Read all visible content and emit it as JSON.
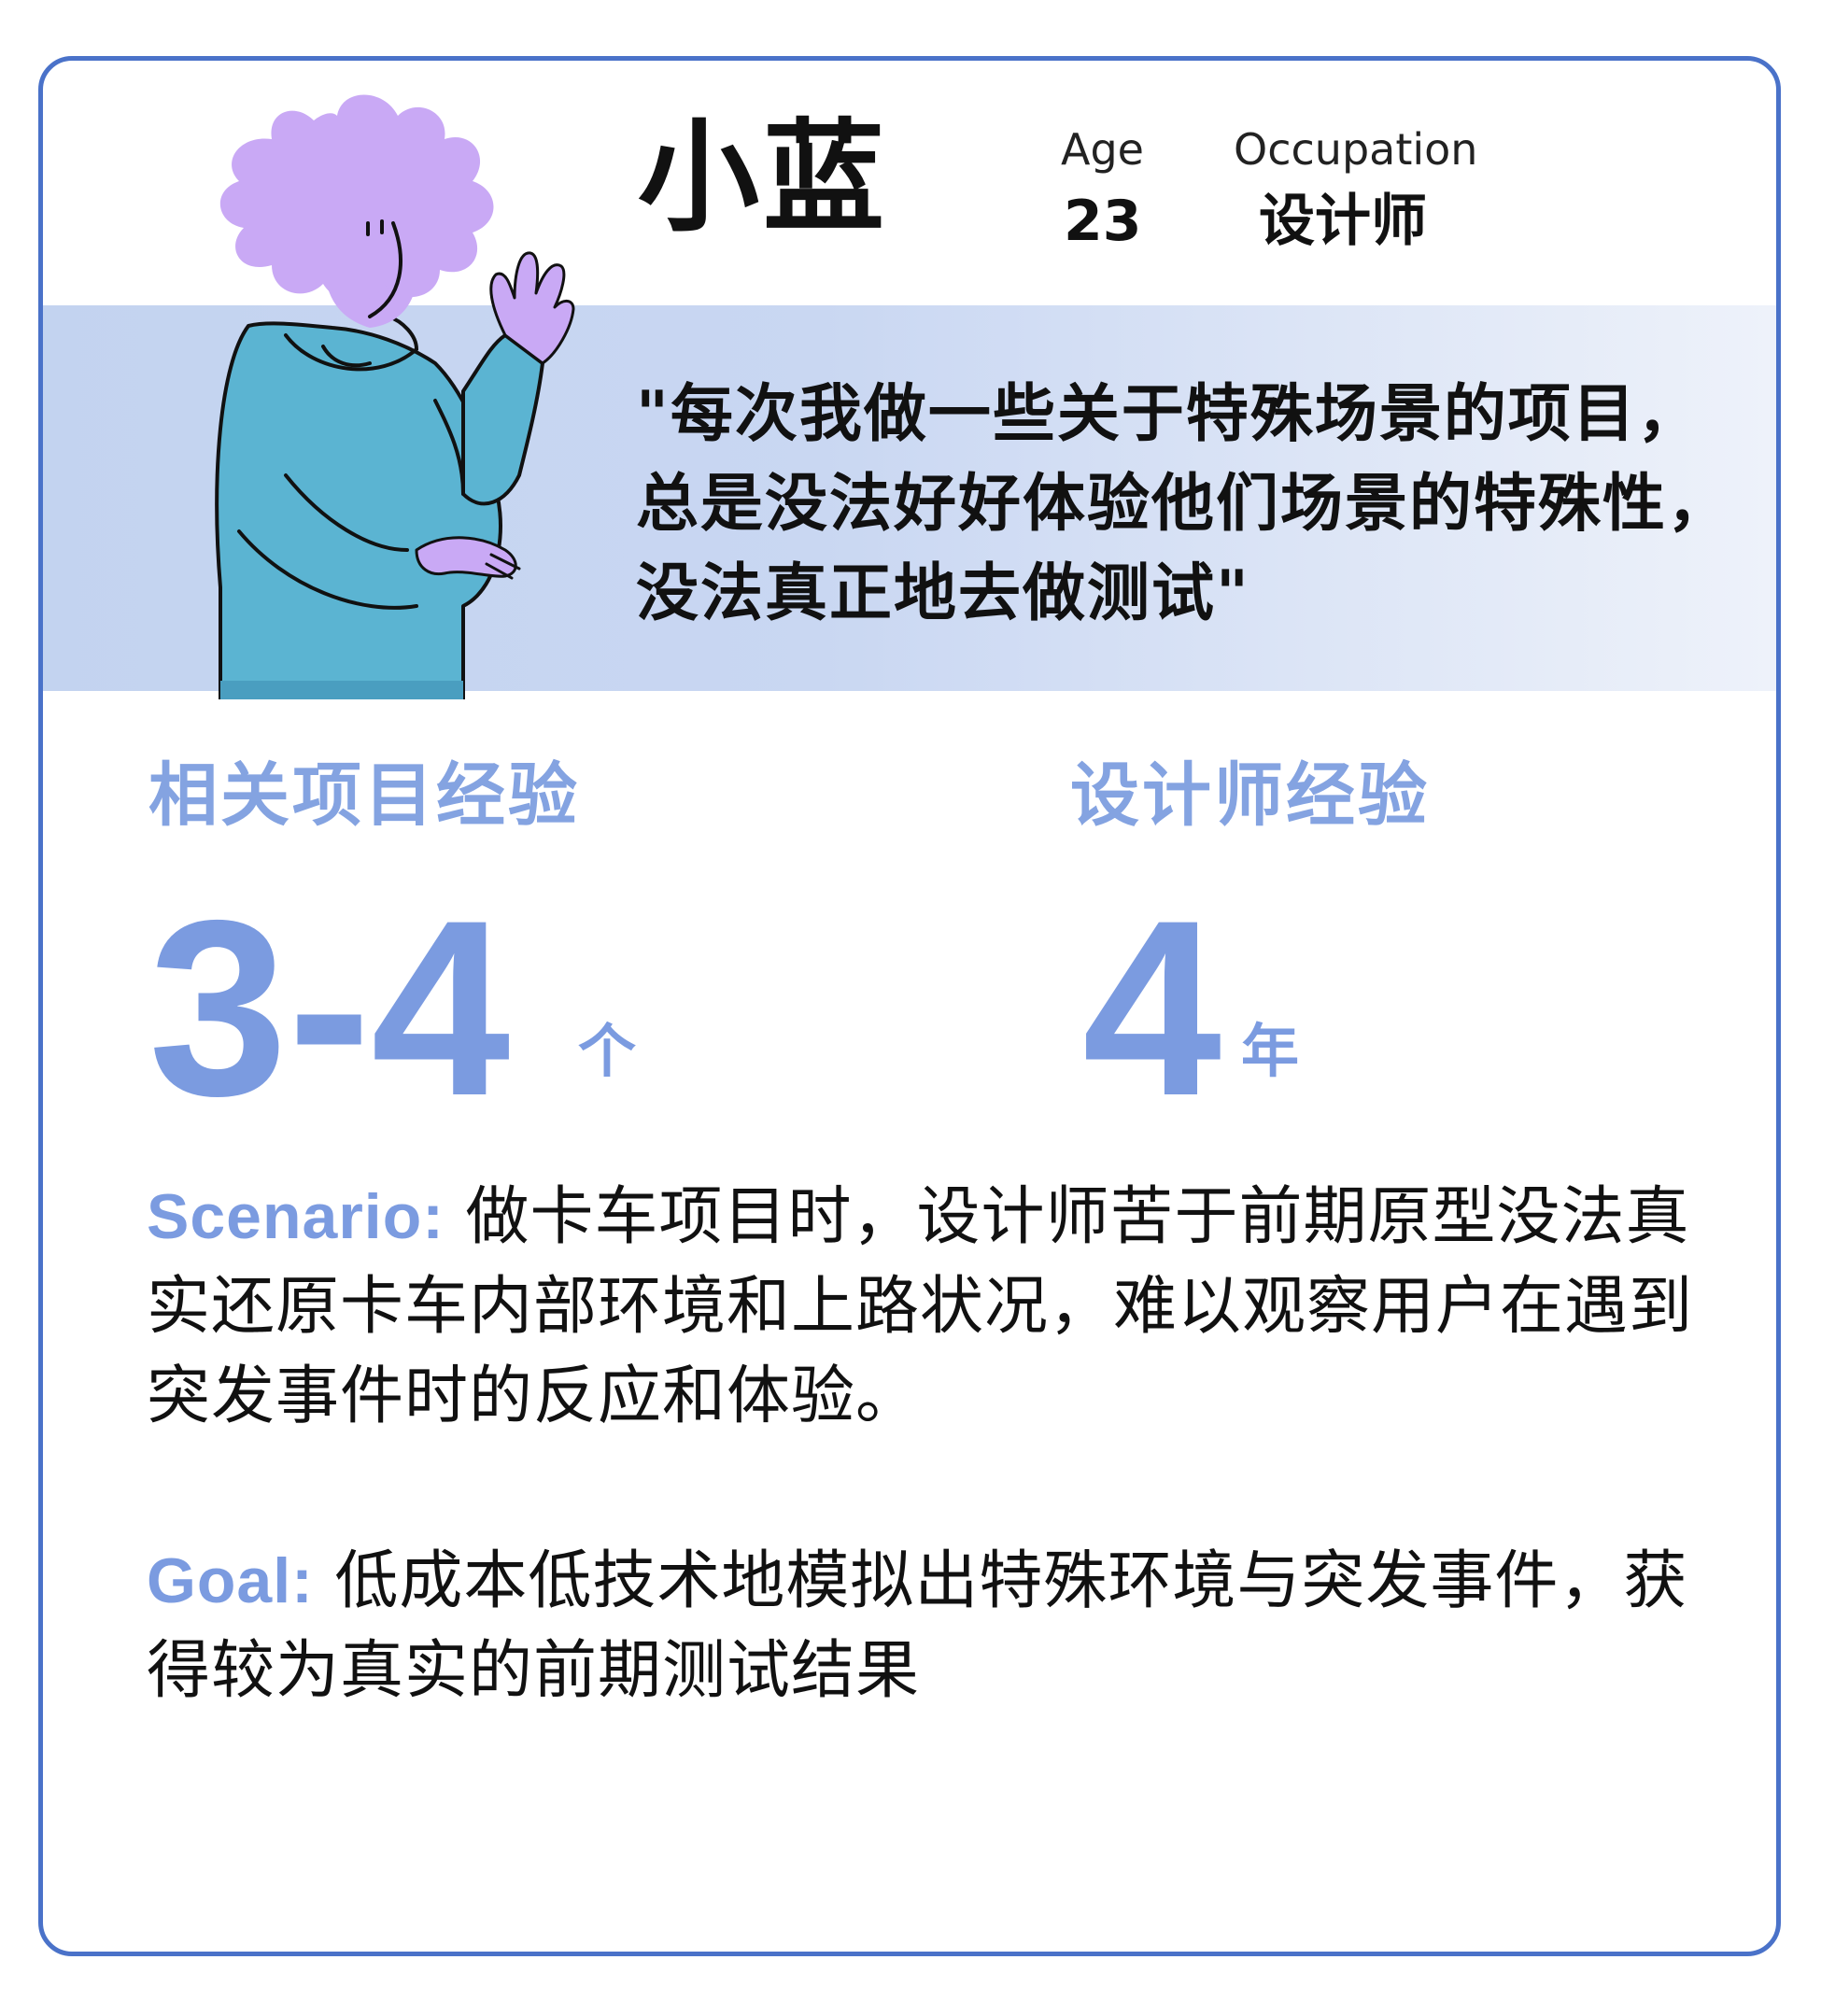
{
  "persona": {
    "name": "小蓝",
    "age_label": "Age",
    "age_value": "23",
    "occupation_label": "Occupation",
    "occupation_value": "设计师",
    "quote": "\"每次我做一些关于特殊场景的项目，总是没法好好体验他们场景的特殊性，没法真正地去做测试\""
  },
  "stats": [
    {
      "label": "相关项目经验",
      "value": "3-4",
      "unit": "个"
    },
    {
      "label": "设计师经验",
      "value": "4",
      "unit": "年"
    }
  ],
  "scenario": {
    "label": "Scenario:",
    "text": "做卡车项目时，设计师苦于前期原型没法真实还原卡车内部环境和上路状况，难以观察用户在遇到突发事件时的反应和体验。"
  },
  "goal": {
    "label": "Goal:",
    "text": "低成本低技术地模拟出特殊环境与突发事件，获得较为真实的前期测试结果"
  },
  "colors": {
    "border": "#4a72c9",
    "accent": "#7b9be0",
    "band": "#c3d3f0",
    "hair": "#c9a9f5",
    "hoodie": "#5bb4d2"
  },
  "icons": {
    "avatar": "waving-person-illustration"
  }
}
